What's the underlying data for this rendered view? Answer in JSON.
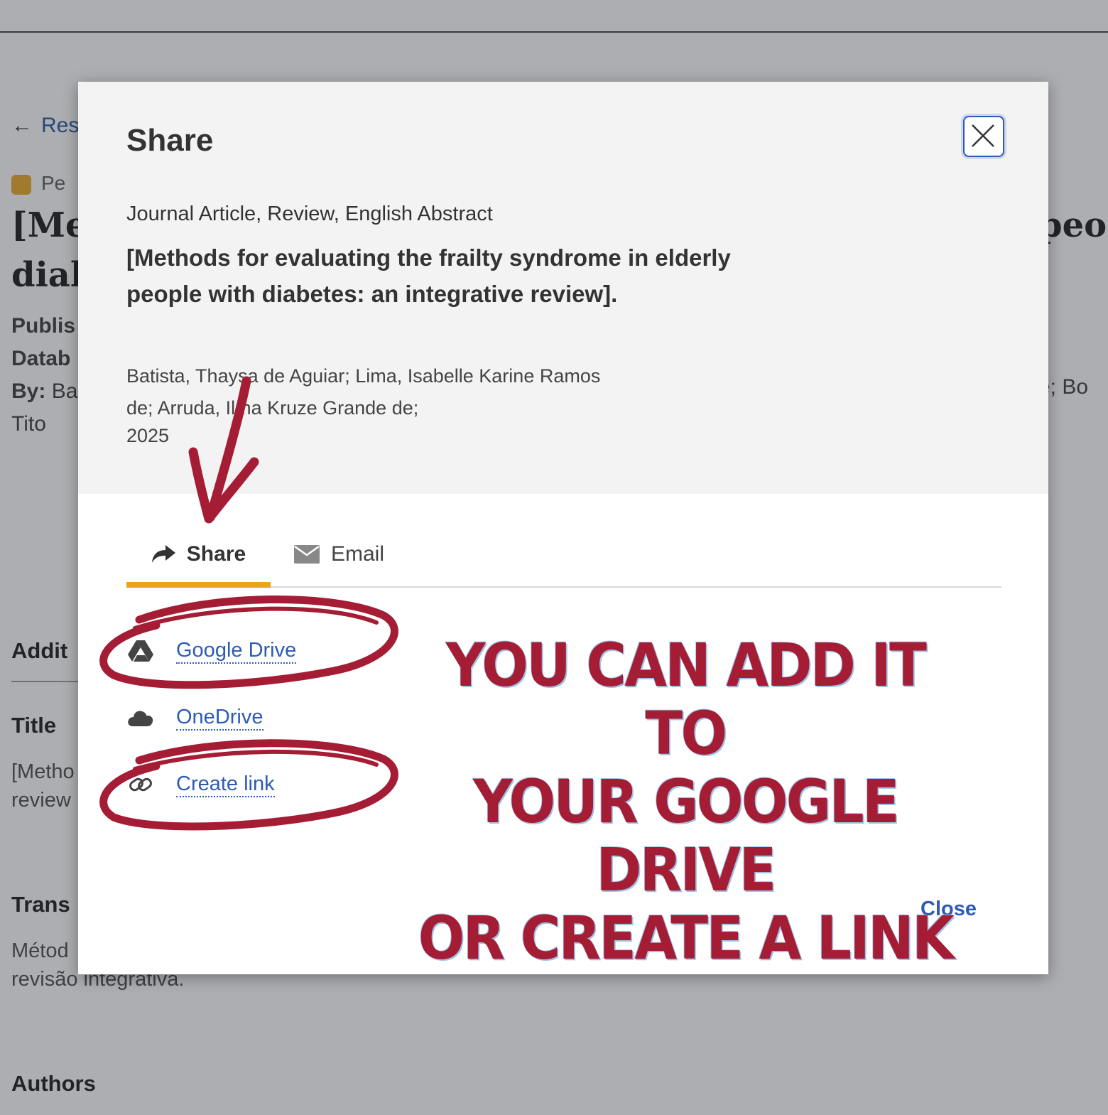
{
  "background": {
    "back_link": "Res",
    "peer_label": "Pe",
    "title_line1": "[Me",
    "title_line2": "dial",
    "title_right": "peo",
    "meta_published": "Publis",
    "meta_database": "Datab",
    "meta_by_label": "By:",
    "meta_by_value": "Ba",
    "meta_by_right": "e; Bo",
    "meta_tito": "Tito",
    "section_additional": "Addit",
    "section_title": "Title",
    "title_text1": "[Metho",
    "title_text2": "review",
    "section_translated": "Trans",
    "translated_text1": "Métod",
    "translated_text2": "revisão integrativa.",
    "section_authors": "Authors"
  },
  "modal": {
    "title": "Share",
    "publication_type": "Journal Article, Review, English Abstract",
    "article_title": "[Methods for evaluating the frailty syndrome in elderly people with diabetes: an integrative review].",
    "authors_line1": "Batista, Thaysa de Aguiar; Lima, Isabelle Karine Ramos",
    "authors_line2": "de; Arruda, Ilma Kruze Grande de;",
    "year": "2025",
    "tabs": [
      {
        "label": "Share",
        "icon": "share-arrow-icon",
        "active": true
      },
      {
        "label": "Email",
        "icon": "envelope-icon",
        "active": false
      }
    ],
    "share_options": [
      {
        "label": "Google Drive",
        "icon": "google-drive-icon"
      },
      {
        "label": "OneDrive",
        "icon": "cloud-icon"
      },
      {
        "label": "Create link",
        "icon": "link-icon"
      }
    ],
    "close_label": "Close"
  },
  "annotation": {
    "callout_line1": "YOU CAN ADD IT TO",
    "callout_line2": "YOUR GOOGLE DRIVE",
    "callout_line3": "OR CREATE A LINK",
    "color": "#a51d34"
  },
  "colors": {
    "accent_tab": "#e9a51c",
    "link": "#2d5bb5",
    "overlay": "rgba(60,62,68,0.42)"
  }
}
